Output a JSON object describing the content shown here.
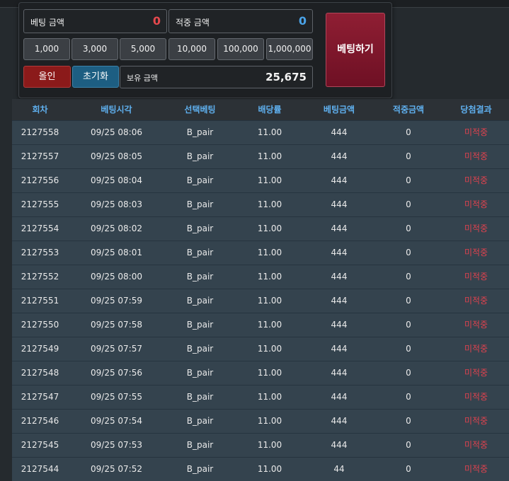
{
  "bet_panel": {
    "bet_amount_label": "베팅 금액",
    "bet_amount_value": "0",
    "win_amount_label": "적중 금액",
    "win_amount_value": "0",
    "chips": [
      "1,000",
      "3,000",
      "5,000",
      "10,000",
      "100,000",
      "1,000,000"
    ],
    "all_in_label": "올인",
    "reset_label": "초기화",
    "balance_label": "보유 금액",
    "balance_value": "25,675",
    "bet_button_label": "베팅하기",
    "colors": {
      "bet_value": "#e5484d",
      "win_value": "#4aa3e8"
    }
  },
  "history": {
    "columns": [
      "회차",
      "베팅시각",
      "선택베팅",
      "배당률",
      "베팅금액",
      "적중금액",
      "당첨결과"
    ],
    "rows": [
      [
        "2127558",
        "09/25 08:06",
        "B_pair",
        "11.00",
        "444",
        "0",
        "미적중"
      ],
      [
        "2127557",
        "09/25 08:05",
        "B_pair",
        "11.00",
        "444",
        "0",
        "미적중"
      ],
      [
        "2127556",
        "09/25 08:04",
        "B_pair",
        "11.00",
        "444",
        "0",
        "미적중"
      ],
      [
        "2127555",
        "09/25 08:03",
        "B_pair",
        "11.00",
        "444",
        "0",
        "미적중"
      ],
      [
        "2127554",
        "09/25 08:02",
        "B_pair",
        "11.00",
        "444",
        "0",
        "미적중"
      ],
      [
        "2127553",
        "09/25 08:01",
        "B_pair",
        "11.00",
        "444",
        "0",
        "미적중"
      ],
      [
        "2127552",
        "09/25 08:00",
        "B_pair",
        "11.00",
        "444",
        "0",
        "미적중"
      ],
      [
        "2127551",
        "09/25 07:59",
        "B_pair",
        "11.00",
        "444",
        "0",
        "미적중"
      ],
      [
        "2127550",
        "09/25 07:58",
        "B_pair",
        "11.00",
        "444",
        "0",
        "미적중"
      ],
      [
        "2127549",
        "09/25 07:57",
        "B_pair",
        "11.00",
        "444",
        "0",
        "미적중"
      ],
      [
        "2127548",
        "09/25 07:56",
        "B_pair",
        "11.00",
        "444",
        "0",
        "미적중"
      ],
      [
        "2127547",
        "09/25 07:55",
        "B_pair",
        "11.00",
        "444",
        "0",
        "미적중"
      ],
      [
        "2127546",
        "09/25 07:54",
        "B_pair",
        "11.00",
        "444",
        "0",
        "미적중"
      ],
      [
        "2127545",
        "09/25 07:53",
        "B_pair",
        "11.00",
        "444",
        "0",
        "미적중"
      ],
      [
        "2127544",
        "09/25 07:52",
        "B_pair",
        "11.00",
        "44",
        "0",
        "미적중"
      ]
    ]
  }
}
